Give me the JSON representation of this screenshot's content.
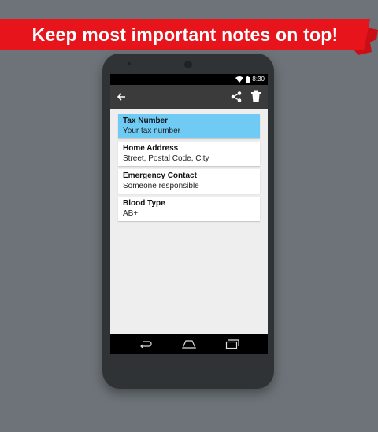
{
  "banner": {
    "text": "Keep most important notes on top!",
    "color": "#e8141b"
  },
  "status_bar": {
    "time": "8:30",
    "icons": [
      "wifi-icon",
      "battery-icon"
    ]
  },
  "toolbar": {
    "icons": [
      "back-arrow-icon",
      "share-icon",
      "trash-icon"
    ]
  },
  "notes": [
    {
      "title": "Tax Number",
      "value": "Your tax number",
      "selected": true
    },
    {
      "title": "Home Address",
      "value": "Street, Postal Code, City",
      "selected": false
    },
    {
      "title": "Emergency Contact",
      "value": "Someone responsible",
      "selected": false
    },
    {
      "title": "Blood Type",
      "value": "AB+",
      "selected": false
    }
  ],
  "nav_bar": {
    "icons": [
      "nav-back-icon",
      "nav-home-icon",
      "nav-recents-icon"
    ]
  },
  "colors": {
    "selected_note": "#6fcbf4",
    "toolbar": "#3b3b3b",
    "background": "#6d7378"
  }
}
